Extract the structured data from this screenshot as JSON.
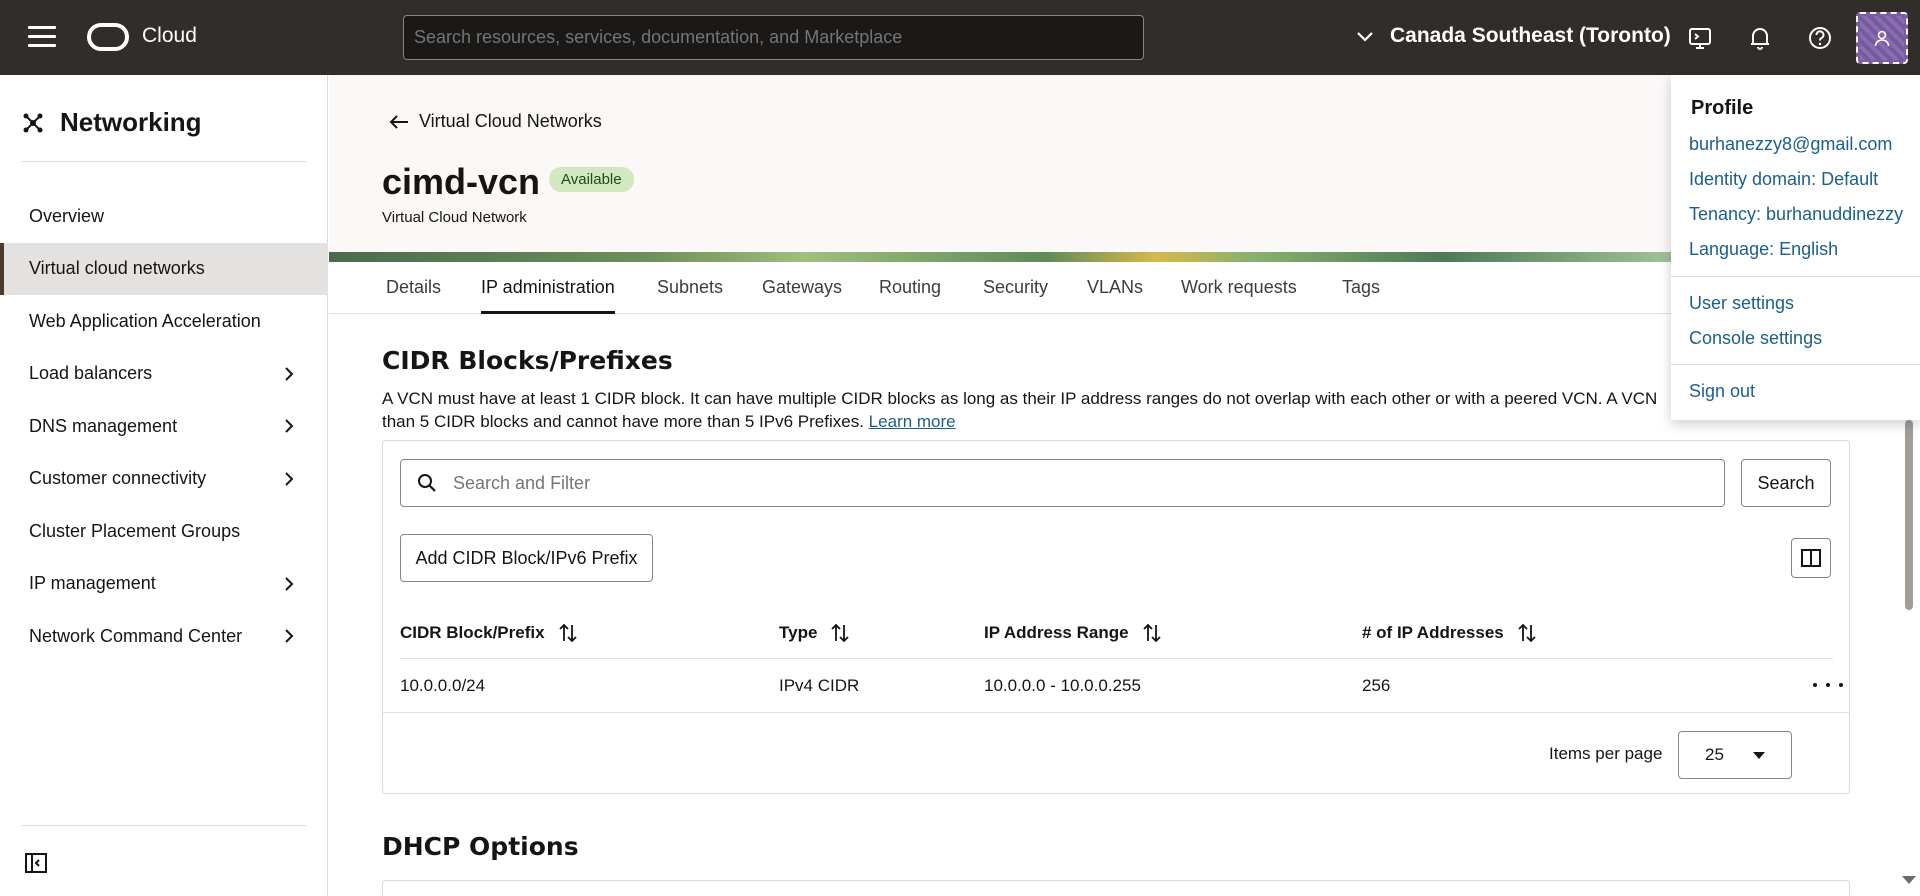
{
  "topbar": {
    "brand": "Cloud",
    "search_placeholder": "Search resources, services, documentation, and Marketplace",
    "region": "Canada Southeast (Toronto)"
  },
  "sidebar": {
    "title": "Networking",
    "items": [
      {
        "label": "Overview"
      },
      {
        "label": "Virtual cloud networks"
      },
      {
        "label": "Web Application Acceleration"
      },
      {
        "label": "Load balancers"
      },
      {
        "label": "DNS management"
      },
      {
        "label": "Customer connectivity"
      },
      {
        "label": "Cluster Placement Groups"
      },
      {
        "label": "IP management"
      },
      {
        "label": "Network Command Center"
      }
    ]
  },
  "header": {
    "back_label": "Virtual Cloud Networks",
    "title": "cimd-vcn",
    "status": "Available",
    "subtitle": "Virtual Cloud Network"
  },
  "tabs": [
    "Details",
    "IP administration",
    "Subnets",
    "Gateways",
    "Routing",
    "Security",
    "VLANs",
    "Work requests",
    "Tags"
  ],
  "cidr": {
    "title": "CIDR Blocks/Prefixes",
    "description": "A VCN must have at least 1 CIDR block. It can have multiple CIDR blocks as long as their IP address ranges do not overlap with each other or with a peered VCN. A VCN",
    "description_line2": "than 5 CIDR blocks and cannot have more than 5 IPv6 Prefixes.",
    "learn_more": "Learn more",
    "filter_placeholder": "Search and Filter",
    "search_button": "Search",
    "add_button": "Add CIDR Block/IPv6 Prefix",
    "columns": [
      "CIDR Block/Prefix",
      "Type",
      "IP Address Range",
      "# of IP Addresses"
    ],
    "rows": [
      {
        "cidr": "10.0.0.0/24",
        "type": "IPv4 CIDR",
        "range": "10.0.0.0 - 10.0.0.255",
        "count": "256"
      }
    ],
    "items_per_page_label": "Items per page",
    "items_per_page": "25"
  },
  "dhcp": {
    "title": "DHCP Options"
  },
  "profile_menu": {
    "title": "Profile",
    "email": "burhanezzy8@gmail.com",
    "identity_domain": "Identity domain: Default",
    "tenancy": "Tenancy: burhanuddinezzy",
    "language": "Language: English",
    "user_settings": "User settings",
    "console_settings": "Console settings",
    "sign_out": "Sign out"
  }
}
